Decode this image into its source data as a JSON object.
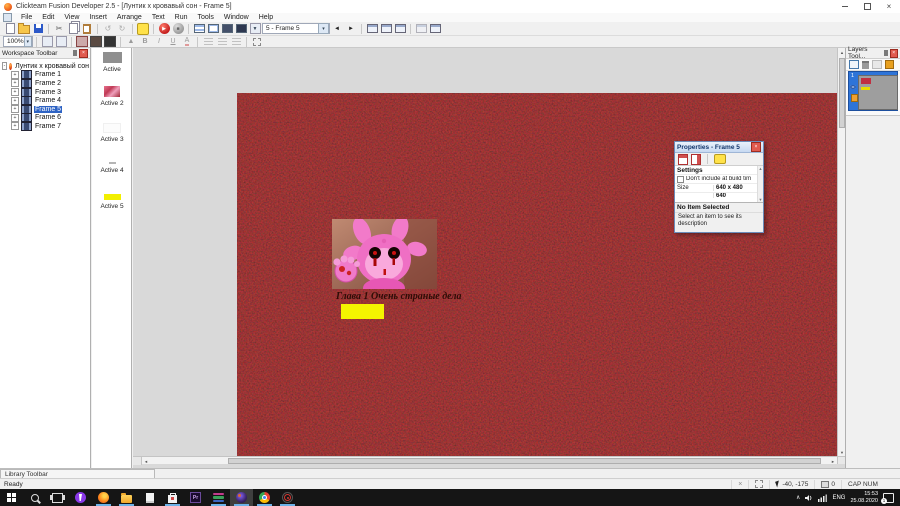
{
  "window": {
    "title": "Clickteam Fusion Developer 2.5 - [Лунтик  х кровавый сон - Frame 5]"
  },
  "icons": {
    "close": "×",
    "up": "▲",
    "down": "▼",
    "left": "◄",
    "right": "►",
    "play": "▶",
    "stop": "■",
    "scissors": "✂",
    "undo": "↺",
    "redo": "↻",
    "dropdown": "▾",
    "expand": "+",
    "collapse": "-",
    "chevron_up": "∧"
  },
  "menu": [
    "File",
    "Edit",
    "View",
    "Insert",
    "Arrange",
    "Text",
    "Run",
    "Tools",
    "Window",
    "Help"
  ],
  "toolbar": {
    "frame_selector": "5 - Frame 5",
    "zoom_level": "100%",
    "bold": "B",
    "italic": "I",
    "underline": "U",
    "font_color": "A"
  },
  "workspace": {
    "title": "Workspace Toolbar",
    "root": "Лунтик  х кровавый сон",
    "frames": [
      "Frame 1",
      "Frame 2",
      "Frame 3",
      "Frame 4",
      "Frame 5",
      "Frame 6",
      "Frame 7"
    ]
  },
  "objects": [
    "Active",
    "Active 2",
    "Active 3",
    "Active 4",
    "Active 5"
  ],
  "canvas": {
    "caption": "Глава 1 Очень страные дела"
  },
  "properties": {
    "title": "Properties - Frame 5",
    "settings_header": "Settings",
    "build_checkbox": "Don't include at build tim",
    "size_label": "Size",
    "size_value": "640 x 480",
    "partial_value": "640",
    "no_item_header": "No Item Selected",
    "no_item_desc": "Select an item to see its description"
  },
  "layers": {
    "title": "Layers Tool...",
    "layer_number": "1"
  },
  "library": {
    "label": "Library Toolbar"
  },
  "statusbar": {
    "ready": "Ready",
    "coords": "-40, -175",
    "zoom": "0",
    "locks": "CAP NUM"
  },
  "taskbar": {
    "lang": "ENG",
    "time": "15:53",
    "date": "25.08.2020",
    "badge": "1",
    "premiere": "Pr"
  }
}
